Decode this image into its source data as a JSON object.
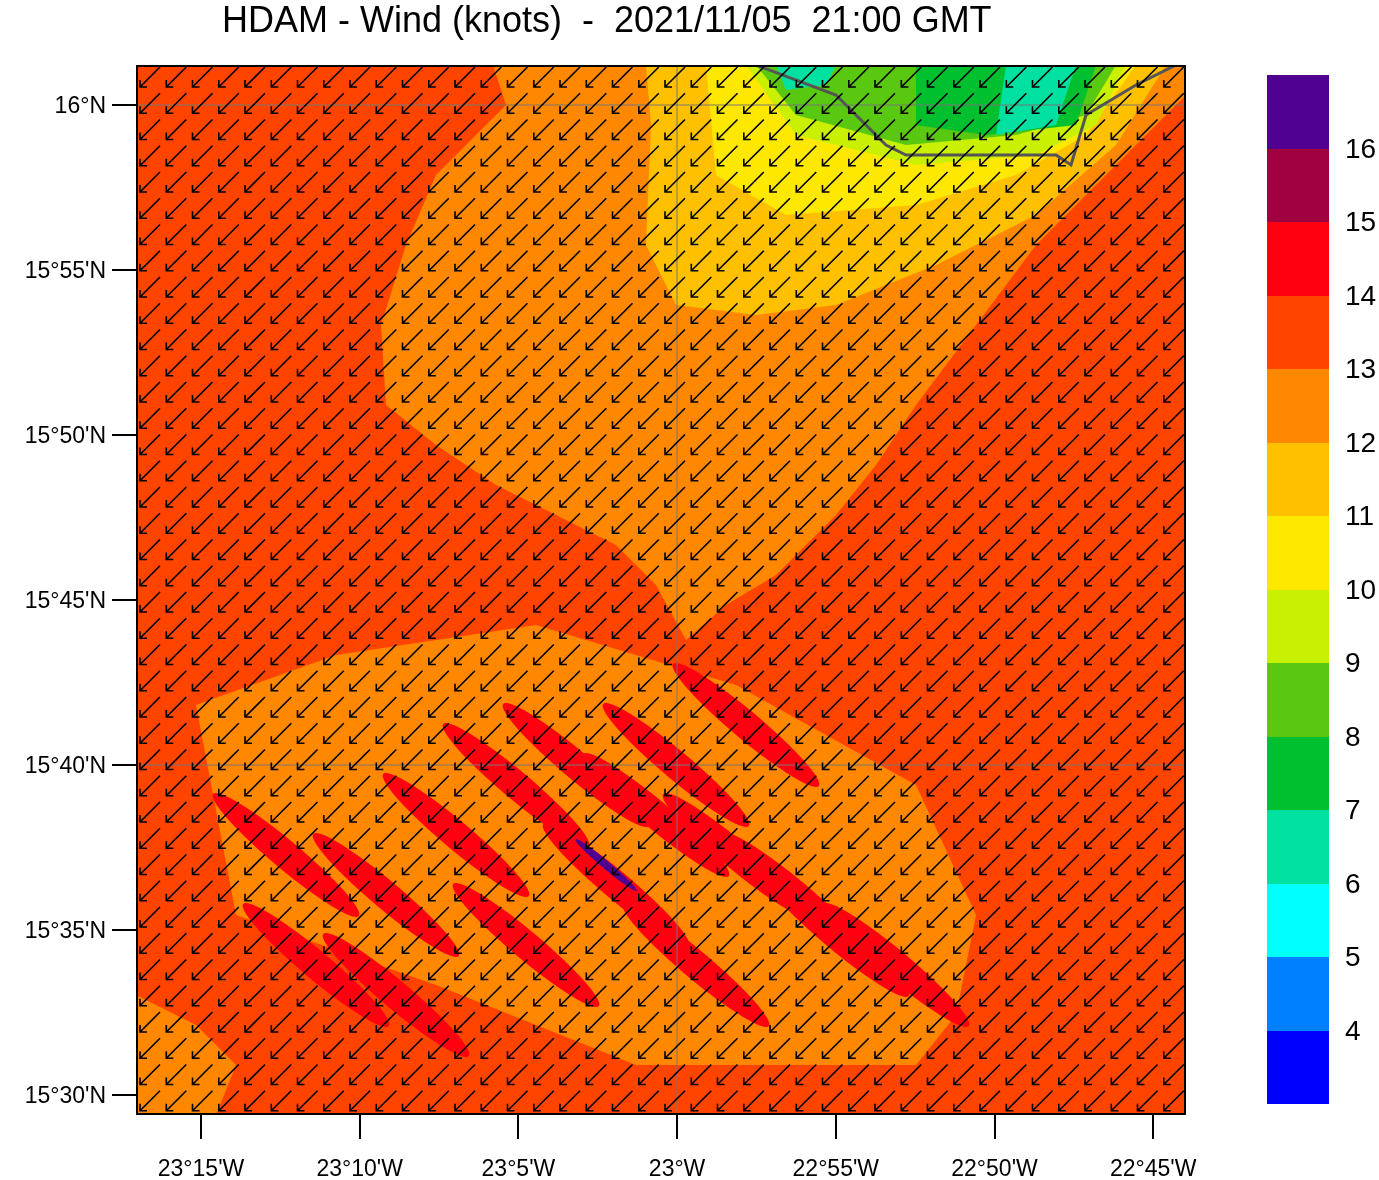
{
  "title": "HDAM - Wind (knots)  -  2021/11/05  21:00 GMT",
  "y_axis": {
    "ticks": [
      "16°N",
      "15°55'N",
      "15°50'N",
      "15°45'N",
      "15°40'N",
      "15°35'N",
      "15°30'N"
    ]
  },
  "x_axis": {
    "ticks": [
      "23°15'W",
      "23°10'W",
      "23°5'W",
      "23°W",
      "22°55'W",
      "22°50'W",
      "22°45'W"
    ]
  },
  "colorbar": {
    "bins": [
      {
        "color": "#500090"
      },
      {
        "color": "#a00040"
      },
      {
        "color": "#ff0010"
      },
      {
        "color": "#ff4400"
      },
      {
        "color": "#ff8800"
      },
      {
        "color": "#ffc000"
      },
      {
        "color": "#ffe800"
      },
      {
        "color": "#c8f000"
      },
      {
        "color": "#58c810"
      },
      {
        "color": "#00c030"
      },
      {
        "color": "#00e0a0"
      },
      {
        "color": "#00ffff"
      },
      {
        "color": "#0080ff"
      },
      {
        "color": "#0000ff"
      }
    ],
    "labels": [
      "16",
      "15",
      "14",
      "13",
      "12",
      "11",
      "10",
      "9",
      "8",
      "7",
      "6",
      "5",
      "4"
    ]
  }
}
